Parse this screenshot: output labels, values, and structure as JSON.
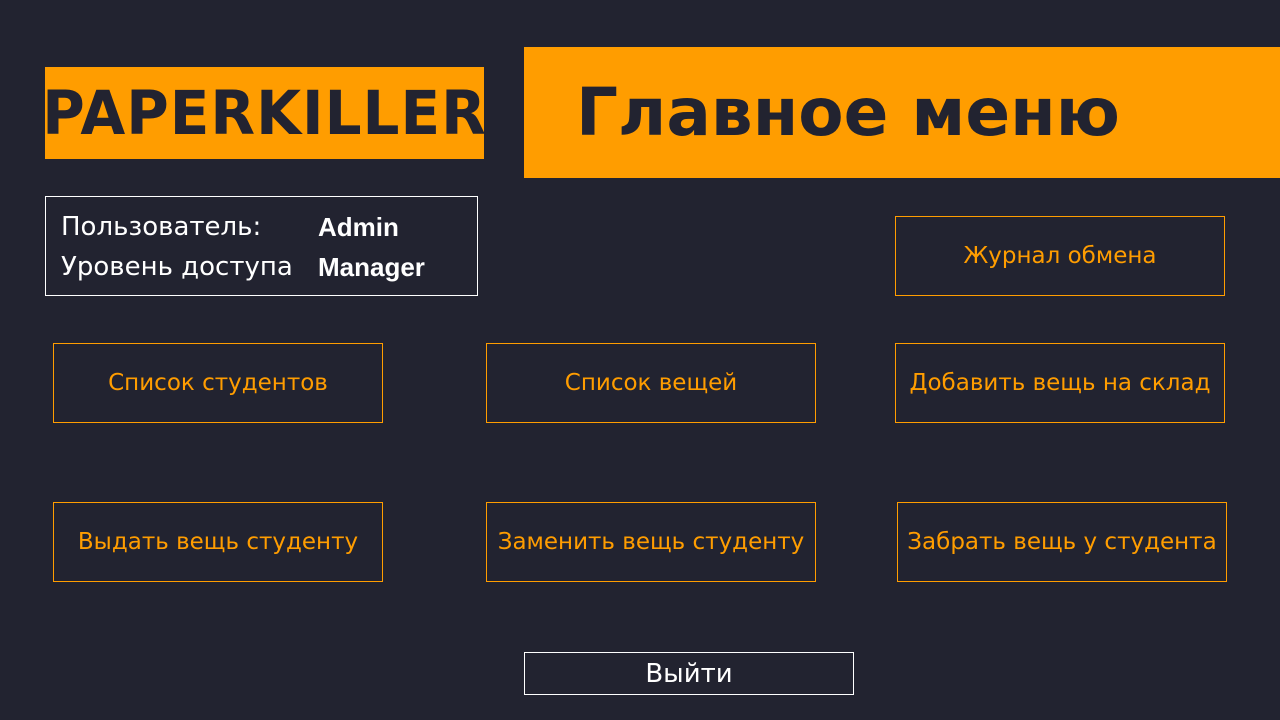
{
  "logo": {
    "text": "PAPERKILLER"
  },
  "header": {
    "title": "Главное меню"
  },
  "user_info": {
    "user_label": "Пользователь:",
    "user_value": "Admin",
    "access_label": "Уровень доступа",
    "access_value": "Manager"
  },
  "menu": {
    "exchange_log": "Журнал обмена",
    "student_list": "Список студентов",
    "item_list": "Список вещей",
    "add_item_to_warehouse": "Добавить вещь на склад",
    "issue_item": "Выдать вещь студенту",
    "replace_item": "Заменить вещь студенту",
    "take_item": "Забрать вещь у студента"
  },
  "exit": {
    "label": "Выйти"
  },
  "colors": {
    "background": "#222330",
    "accent": "#ff9d00",
    "text_light": "#ffffff"
  }
}
